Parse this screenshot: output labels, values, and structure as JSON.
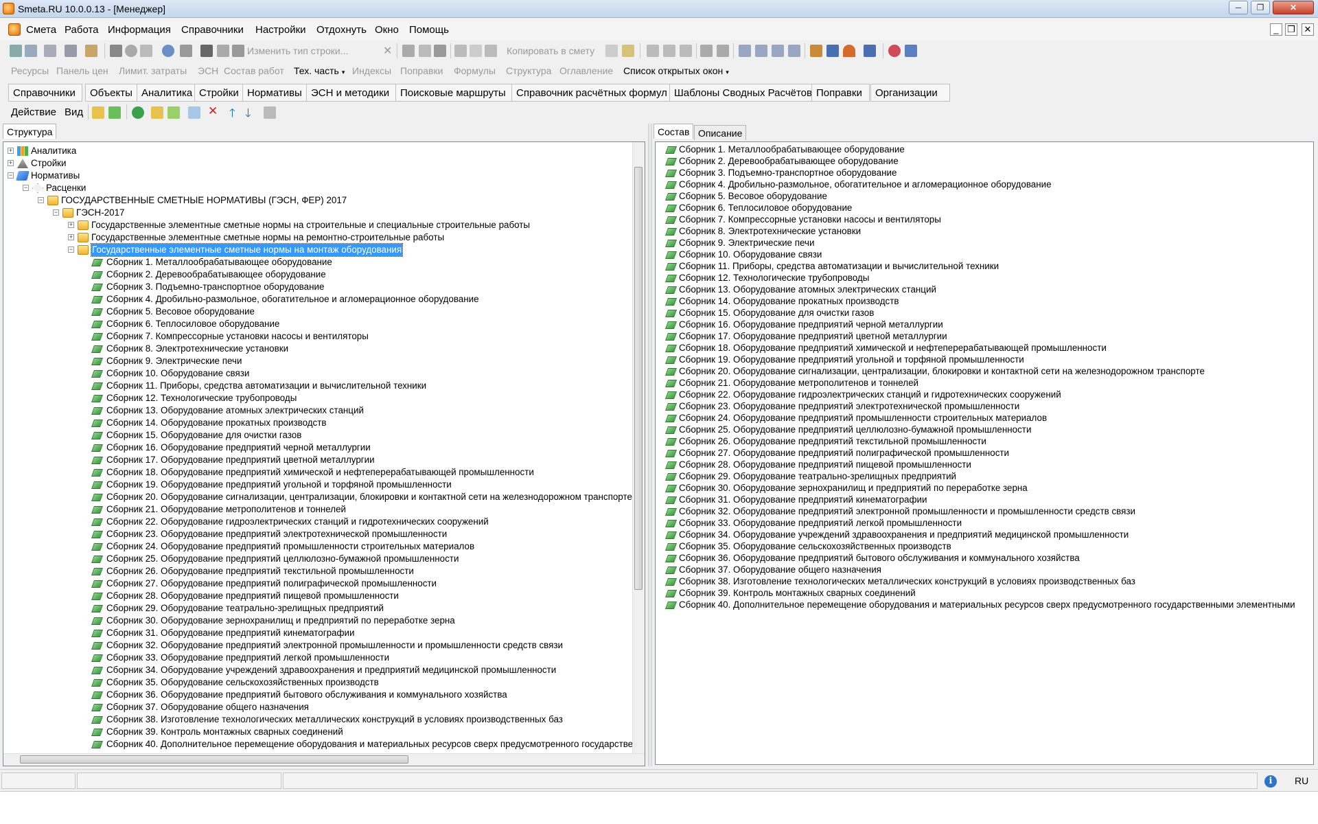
{
  "window": {
    "title": "Smeta.RU  10.0.0.13   - [Менеджер]",
    "controls": [
      "─",
      "❐",
      "✕"
    ],
    "mdi_controls": [
      "_",
      "❐",
      "✕"
    ]
  },
  "menu": [
    "Смета",
    "Работа",
    "Информация",
    "Справочники",
    "Настройки",
    "Отдохнуть",
    "Окно",
    "Помощь"
  ],
  "toolbar1": {
    "change_row_type": "Изменить тип строки...",
    "copy_to_estimate": "Копировать в смету"
  },
  "toolbar2": {
    "items": [
      "Ресурсы",
      "Панель цен",
      "Лимит. затраты",
      "ЭСН",
      "Состав работ",
      "Тех. часть",
      "Индексы",
      "Поправки",
      "Формулы",
      "Структура",
      "Оглавление",
      "Список открытых окон"
    ],
    "caret": "▾"
  },
  "tabs": [
    "Справочники",
    "Объекты",
    "Аналитика",
    "Стройки",
    "Нормативы",
    "ЭСН и методики",
    "Поисковые маршруты",
    "Справочник расчётных формул",
    "Шаблоны Сводных Расчётов",
    "Поправки",
    "Организации"
  ],
  "actionbar": {
    "action": "Действие",
    "view": "Вид"
  },
  "left_panel": {
    "tab": "Структура",
    "tree_top": [
      {
        "label": "Аналитика",
        "expander": "+"
      },
      {
        "label": "Стройки",
        "expander": "+"
      },
      {
        "label": "Нормативы",
        "expander": "−"
      },
      {
        "label": "Расценки",
        "expander": "−"
      },
      {
        "label": "ГОСУДАРСТВЕННЫЕ СМЕТНЫЕ НОРМАТИВЫ (ГЭСН, ФЕР) 2017",
        "expander": "−"
      },
      {
        "label": "ГЭСН-2017",
        "expander": "−"
      },
      {
        "label": "Государственные элементные сметные нормы на строительные и специальные строительные работы",
        "expander": "+"
      },
      {
        "label": "Государственные элементные сметные нормы на ремонтно-строительные работы",
        "expander": "+"
      },
      {
        "label": "Государственные элементные сметные нормы на монтаж оборудования",
        "expander": "−"
      }
    ]
  },
  "right_panel": {
    "tabs": [
      "Состав",
      "Описание"
    ]
  },
  "collections": [
    "Сборник 1. Металлообрабатывающее оборудование",
    "Сборник 2. Деревообрабатывающее оборудование",
    "Сборник 3. Подъемно-транспортное оборудование",
    "Сборник 4. Дробильно-размольное, обогатительное и агломерационное оборудование",
    "Сборник 5. Весовое оборудование",
    "Сборник 6. Теплосиловое оборудование",
    "Сборник 7. Компрессорные установки насосы и вентиляторы",
    "Сборник 8. Электротехнические установки",
    "Сборник 9. Электрические печи",
    "Сборник 10. Оборудование связи",
    "Сборник 11. Приборы, средства автоматизации и вычислительной техники",
    "Сборник 12. Технологические трубопроводы",
    "Сборник 13. Оборудование атомных электрических станций",
    "Сборник 14. Оборудование прокатных производств",
    "Сборник 15. Оборудование для очистки газов",
    "Сборник 16. Оборудование предприятий черной металлургии",
    "Сборник 17. Оборудование предприятий цветной металлургии",
    "Сборник 18. Оборудование предприятий химической и нефтеперерабатывающей промышленности",
    "Сборник 19. Оборудование предприятий угольной и торфяной промышленности",
    "Сборник 20. Оборудование сигнализации, централизации, блокировки и контактной сети на железнодорожном транспорте",
    "Сборник 21. Оборудование метрополитенов и тоннелей",
    "Сборник 22. Оборудование гидроэлектрических станций и гидротехнических сооружений",
    "Сборник 23. Оборудование предприятий электротехнической промышленности",
    "Сборник 24. Оборудование предприятий промышленности строительных материалов",
    "Сборник 25. Оборудование предприятий целлюлозно-бумажной промышленности",
    "Сборник 26. Оборудование предприятий текстильной промышленности",
    "Сборник 27. Оборудование предприятий полиграфической промышленности",
    "Сборник 28. Оборудование предприятий пищевой промышленности",
    "Сборник 29. Оборудование театрально-зрелищных предприятий",
    "Сборник 30. Оборудование зернохранилищ и предприятий по переработке зерна",
    "Сборник 31. Оборудование предприятий кинематографии",
    "Сборник 32. Оборудование предприятий электронной промышленности и промышленности средств связи",
    "Сборник 33. Оборудование предприятий легкой промышленности",
    "Сборник 34. Оборудование учреждений здравоохранения и предприятий медицинской промышленности",
    "Сборник 35. Оборудование сельскохозяйственных производств",
    "Сборник 36. Оборудование предприятий бытового обслуживания и коммунального хозяйства",
    "Сборник 37. Оборудование общего назначения",
    "Сборник 38. Изготовление технологических металлических конструкций в условиях производственных баз",
    "Сборник 39. Контроль монтажных сварных соединений",
    "Сборник 40. Дополнительное перемещение оборудования и материальных ресурсов сверх предусмотренного государственными элементными"
  ],
  "statusbar": {
    "info": "i",
    "language": "RU"
  },
  "colors": {
    "selection": "#3399ff",
    "titlebar": "#c4d6ec"
  }
}
